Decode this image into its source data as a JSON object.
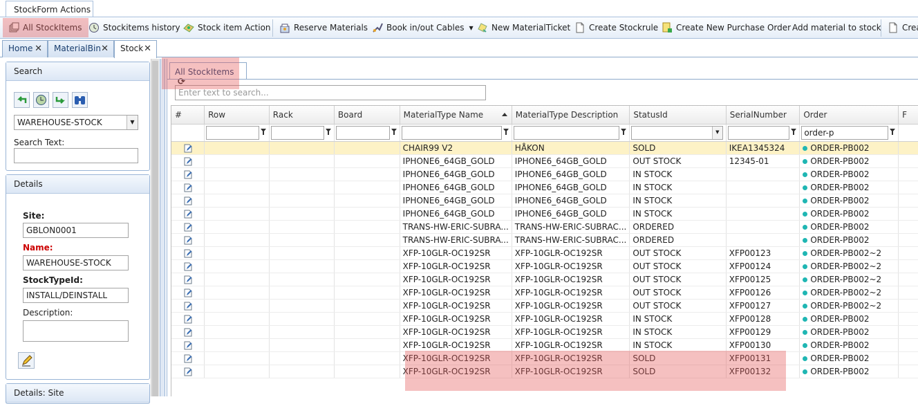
{
  "ribbon": {
    "tab_label": "StockForm Actions"
  },
  "toolbar": {
    "all_stockitems": "All StockItems",
    "stockitems_history": "Stockitems history",
    "stock_item_action": "Stock item Action",
    "reserve_materials": "Reserve Materials",
    "book_cables": "Book in/out Cables",
    "new_materialticket": "New MaterialTicket",
    "create_stockrule": "Create Stockrule",
    "create_purchase_order": "Create New Purchase Order",
    "add_material": "Add material to stock",
    "create_trunc": "Crea"
  },
  "doc_tabs": [
    {
      "label": "Home"
    },
    {
      "label": "MaterialBin"
    },
    {
      "label": "Stock"
    }
  ],
  "search_panel": {
    "title": "Search",
    "warehouse_value": "WAREHOUSE-STOCK",
    "search_text_label": "Search Text:",
    "search_text_value": ""
  },
  "details_panel": {
    "title": "Details",
    "site_label": "Site:",
    "site_value": "GBLON0001",
    "name_label": "Name:",
    "name_value": "WAREHOUSE-STOCK",
    "stocktype_label": "StockTypeId:",
    "stocktype_value": "INSTALL/DEINSTALL",
    "description_label": "Description:",
    "description_value": ""
  },
  "details_site_panel": {
    "title": "Details: Site"
  },
  "main": {
    "subtab_label": "All StockItems",
    "search_placeholder": "Enter text to search...",
    "columns": [
      "#",
      "Row",
      "Rack",
      "Board",
      "MaterialType Name",
      "MaterialType Description",
      "StatusId",
      "SerialNumber",
      "Order",
      "F"
    ],
    "order_filter_value": "order-p",
    "rows": [
      {
        "mt_name": "CHAIR99 V2",
        "mt_desc": "HÅKON",
        "status": "SOLD",
        "serial": "IKEA1345324",
        "order": "ORDER-PB002"
      },
      {
        "mt_name": "IPHONE6_64GB_GOLD",
        "mt_desc": "IPHONE6_64GB_GOLD",
        "status": "OUT STOCK",
        "serial": "12345-01",
        "order": "ORDER-PB002"
      },
      {
        "mt_name": "IPHONE6_64GB_GOLD",
        "mt_desc": "IPHONE6_64GB_GOLD",
        "status": "IN STOCK",
        "serial": "",
        "order": "ORDER-PB002"
      },
      {
        "mt_name": "IPHONE6_64GB_GOLD",
        "mt_desc": "IPHONE6_64GB_GOLD",
        "status": "IN STOCK",
        "serial": "",
        "order": "ORDER-PB002"
      },
      {
        "mt_name": "IPHONE6_64GB_GOLD",
        "mt_desc": "IPHONE6_64GB_GOLD",
        "status": "IN STOCK",
        "serial": "",
        "order": "ORDER-PB002"
      },
      {
        "mt_name": "IPHONE6_64GB_GOLD",
        "mt_desc": "IPHONE6_64GB_GOLD",
        "status": "IN STOCK",
        "serial": "",
        "order": "ORDER-PB002"
      },
      {
        "mt_name": "TRANS-HW-ERIC-SUBRA...",
        "mt_desc": "TRANS-HW-ERIC-SUBRAC...",
        "status": "ORDERED",
        "serial": "",
        "order": "ORDER-PB002"
      },
      {
        "mt_name": "TRANS-HW-ERIC-SUBRA...",
        "mt_desc": "TRANS-HW-ERIC-SUBRAC...",
        "status": "ORDERED",
        "serial": "",
        "order": "ORDER-PB002"
      },
      {
        "mt_name": "XFP-10GLR-OC192SR",
        "mt_desc": "XFP-10GLR-OC192SR",
        "status": "OUT STOCK",
        "serial": "XFP00123",
        "order": "ORDER-PB002~2"
      },
      {
        "mt_name": "XFP-10GLR-OC192SR",
        "mt_desc": "XFP-10GLR-OC192SR",
        "status": "OUT STOCK",
        "serial": "XFP00124",
        "order": "ORDER-PB002~2"
      },
      {
        "mt_name": "XFP-10GLR-OC192SR",
        "mt_desc": "XFP-10GLR-OC192SR",
        "status": "OUT STOCK",
        "serial": "XFP00125",
        "order": "ORDER-PB002~2"
      },
      {
        "mt_name": "XFP-10GLR-OC192SR",
        "mt_desc": "XFP-10GLR-OC192SR",
        "status": "OUT STOCK",
        "serial": "XFP00126",
        "order": "ORDER-PB002~2"
      },
      {
        "mt_name": "XFP-10GLR-OC192SR",
        "mt_desc": "XFP-10GLR-OC192SR",
        "status": "OUT STOCK",
        "serial": "XFP00127",
        "order": "ORDER-PB002~2"
      },
      {
        "mt_name": "XFP-10GLR-OC192SR",
        "mt_desc": "XFP-10GLR-OC192SR",
        "status": "IN STOCK",
        "serial": "XFP00128",
        "order": "ORDER-PB002"
      },
      {
        "mt_name": "XFP-10GLR-OC192SR",
        "mt_desc": "XFP-10GLR-OC192SR",
        "status": "IN STOCK",
        "serial": "XFP00129",
        "order": "ORDER-PB002"
      },
      {
        "mt_name": "XFP-10GLR-OC192SR",
        "mt_desc": "XFP-10GLR-OC192SR",
        "status": "IN STOCK",
        "serial": "XFP00130",
        "order": "ORDER-PB002"
      },
      {
        "mt_name": "XFP-10GLR-OC192SR",
        "mt_desc": "XFP-10GLR-OC192SR",
        "status": "SOLD",
        "serial": "XFP00131",
        "order": "ORDER-PB002"
      },
      {
        "mt_name": "XFP-10GLR-OC192SR",
        "mt_desc": "XFP-10GLR-OC192SR",
        "status": "SOLD",
        "serial": "XFP00132",
        "order": "ORDER-PB002"
      }
    ]
  },
  "colors": {
    "accent": "#99b4d6",
    "selected_row": "#fdf2c6",
    "highlight": "#e65a5a",
    "order_dot": "#1fb6b3",
    "required_label": "#cc0000"
  }
}
